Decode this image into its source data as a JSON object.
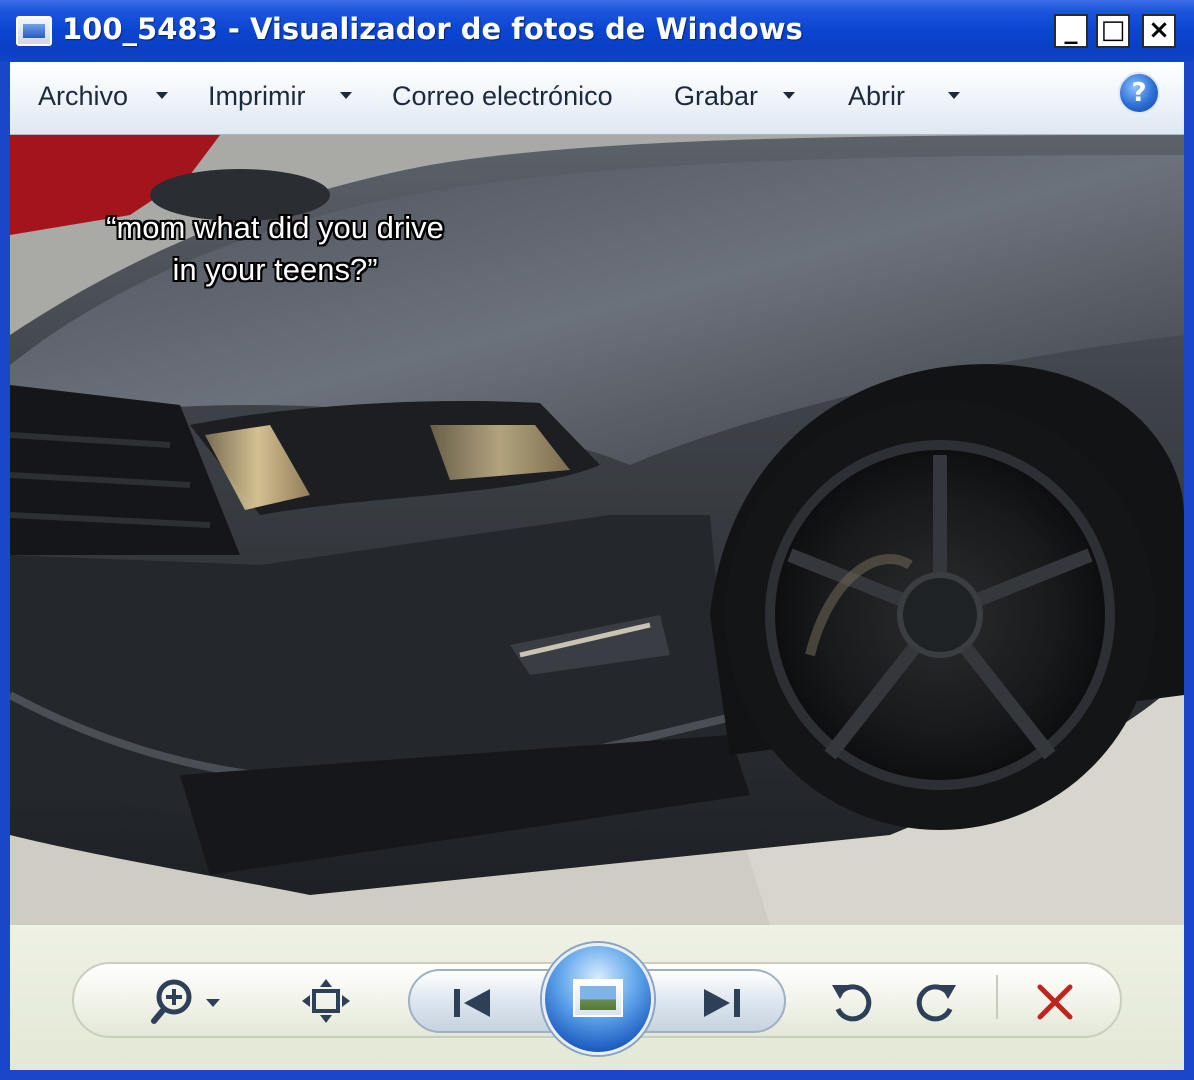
{
  "window": {
    "title": "100_5483 - Visualizador de fotos de Windows",
    "minimize": "_",
    "maximize": "□",
    "close": "×"
  },
  "menu": {
    "items": [
      {
        "label": "Archivo",
        "has_dropdown": true
      },
      {
        "label": "Imprimir",
        "has_dropdown": true
      },
      {
        "label": "Correo electrónico",
        "has_dropdown": false
      },
      {
        "label": "Grabar",
        "has_dropdown": true
      },
      {
        "label": "Abrir",
        "has_dropdown": true
      }
    ],
    "help": "?"
  },
  "photo": {
    "caption_line1": "“mom what did you drive",
    "caption_line2": "in your teens?”"
  },
  "controls": {
    "zoom": "zoom-icon",
    "fit": "fit-to-window-icon",
    "previous": "previous-icon",
    "slideshow": "slideshow-icon",
    "next": "next-icon",
    "rotate_left": "rotate-counterclockwise-icon",
    "rotate_right": "rotate-clockwise-icon",
    "delete": "delete-icon"
  },
  "colors": {
    "titlebar": "#0a45d1",
    "delete": "#c0241c",
    "control_icon": "#2e4058"
  }
}
